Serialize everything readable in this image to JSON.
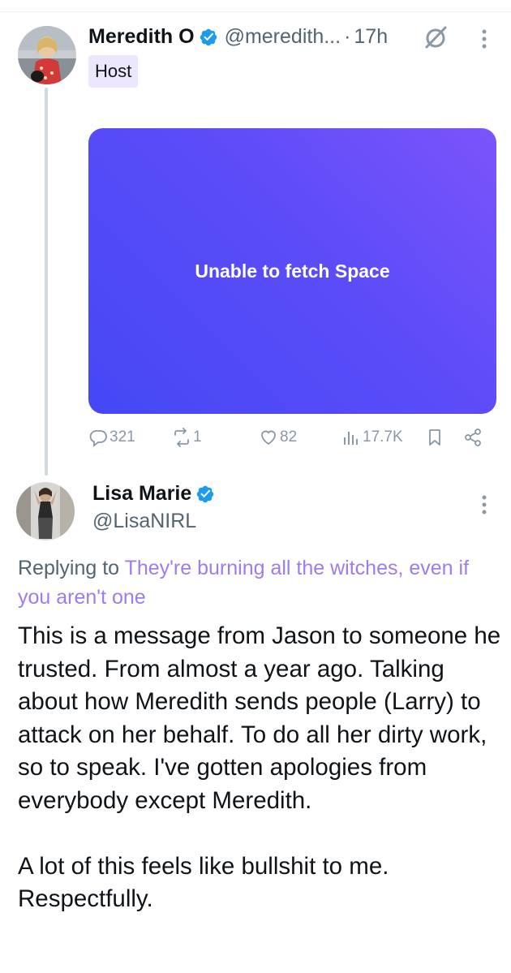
{
  "tweet_top": {
    "author": {
      "display_name": "Meredith O",
      "handle": "@meredith...",
      "separator": "·",
      "time": "17h",
      "verified": true
    },
    "badge": "Host",
    "space_card": {
      "message": "Unable to fetch Space"
    },
    "actions": {
      "replies": "321",
      "reposts": "1",
      "likes": "82",
      "views": "17.7K"
    }
  },
  "tweet_reply": {
    "author": {
      "display_name": "Lisa Marie",
      "handle": "@LisaNIRL",
      "verified": true
    },
    "replying_prefix": "Replying to ",
    "replying_target": "They're burning all the witches, even if you aren't one",
    "body": "This is a message from Jason to someone he trusted. From almost a year ago. Talking about how Meredith sends people (Larry) to attack on her behalf. To do all her dirty work, so to speak. I've gotten apologies from everybody except Meredith.\n\nA lot of this feels like bullshit to me. Respectfully."
  },
  "colors": {
    "verified": "#1d9bf0",
    "host_badge_bg": "#ede7fe",
    "space_gradient_start": "#4548f5",
    "space_gradient_end": "#7b54fb",
    "reply_target": "#9f7ceb",
    "secondary_text": "#536471"
  },
  "icons": [
    "verified-badge-icon",
    "space-icon",
    "more-options-icon",
    "reply-icon",
    "repost-icon",
    "like-icon",
    "views-icon",
    "bookmark-icon",
    "share-icon"
  ]
}
